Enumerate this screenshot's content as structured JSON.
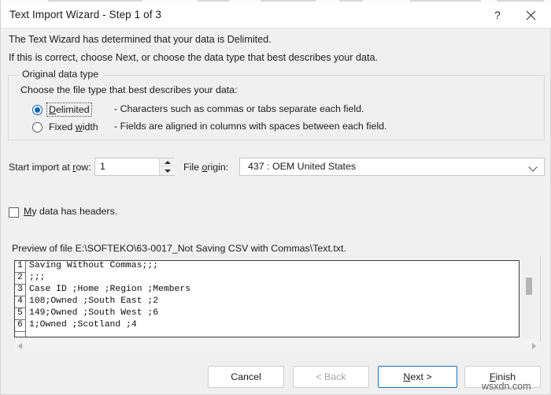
{
  "window": {
    "title": "Text Import Wizard - Step 1 of 3",
    "help_label": "?",
    "close_label": "✕"
  },
  "description": {
    "line1": "The Text Wizard has determined that your data is Delimited.",
    "line2": "If this is correct, choose Next, or choose the data type that best describes your data."
  },
  "original_data_type": {
    "legend": "Original data type",
    "instruction": "Choose the file type that best describes your data:",
    "options": [
      {
        "label_prefix": "",
        "label_accel": "D",
        "label_rest": "elimited",
        "description": "- Characters such as commas or tabs separate each field.",
        "selected": true,
        "focused": true
      },
      {
        "label_prefix": "Fixed ",
        "label_accel": "w",
        "label_rest": "idth",
        "description": "- Fields are aligned in columns with spaces between each field.",
        "selected": false,
        "focused": false
      }
    ]
  },
  "start_import": {
    "label_prefix": "Start import at ",
    "label_accel": "r",
    "label_rest": "ow:",
    "value": "1"
  },
  "file_origin": {
    "label_prefix": "File ",
    "label_accel": "o",
    "label_rest": "rigin:",
    "value": "437 : OEM United States"
  },
  "headers_checkbox": {
    "label_accel": "M",
    "label_rest": "y data has headers.",
    "checked": false
  },
  "preview": {
    "label": "Preview of file E:\\SOFTEKO\\63-0017_Not Saving CSV with Commas\\Text.txt.",
    "lines": [
      {
        "num": "1",
        "text": "Saving Without Commas;;;"
      },
      {
        "num": "2",
        "text": ";;;"
      },
      {
        "num": "3",
        "text": "Case ID ;Home ;Region ;Members"
      },
      {
        "num": "4",
        "text": "108;Owned ;South East ;2"
      },
      {
        "num": "5",
        "text": "149;Owned ;South West ;6"
      },
      {
        "num": "6",
        "text": "1;Owned ;Scotland ;4"
      }
    ]
  },
  "footer": {
    "cancel": "Cancel",
    "back": "< Back",
    "next_accel": "N",
    "next_rest": "ext >",
    "finish_accel": "F",
    "finish_rest": "inish"
  },
  "watermark": "wsxdn.com",
  "colors": {
    "dialog_bg": "#f0f0f0",
    "titlebar_bg": "#ffffff",
    "accent_focus": "#1673bb",
    "radio_accent": "#0b66b5",
    "text": "#1b1b1b",
    "disabled_text": "#a6a6a6"
  }
}
